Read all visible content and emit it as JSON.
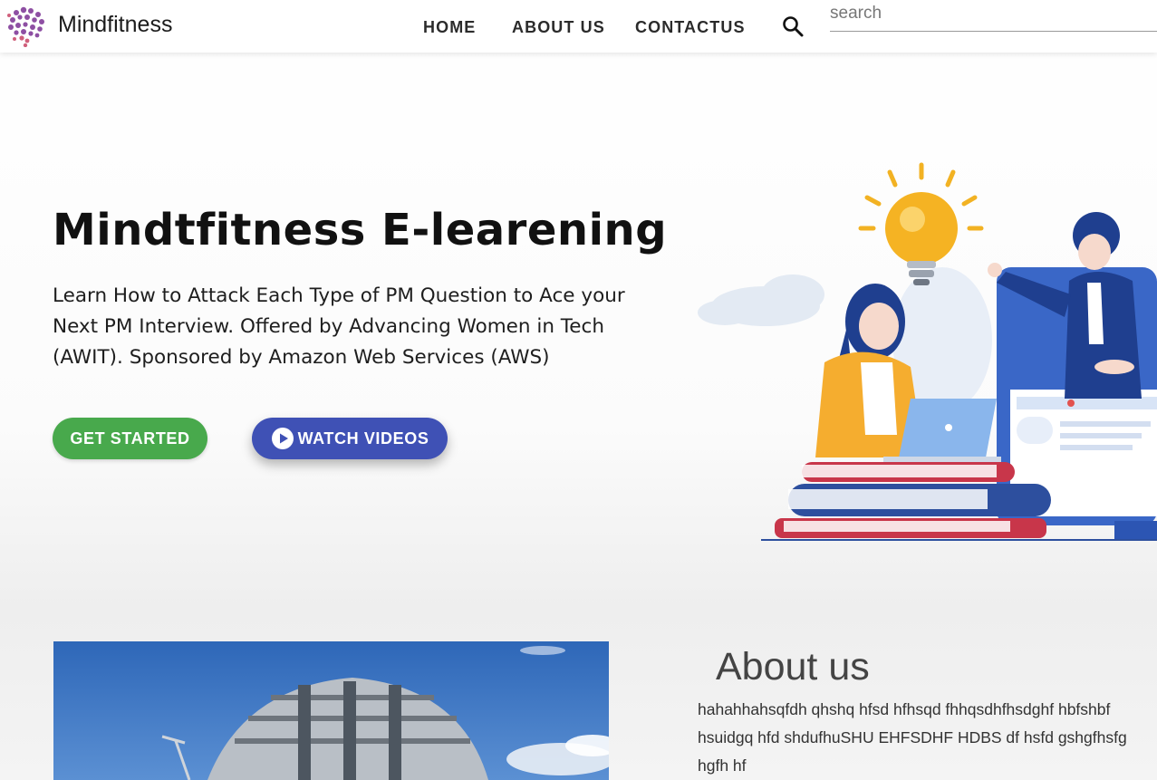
{
  "brand": {
    "name": "Mindfitness",
    "logo_icon": "brain-icon"
  },
  "nav": {
    "home": "HOME",
    "about": "ABOUT US",
    "contact": "CONTACTUS"
  },
  "search": {
    "icon": "search-icon",
    "placeholder": "search",
    "value": ""
  },
  "hero": {
    "title": "Mindtfitness E-learening",
    "subtitle": "Learn How to Attack Each Type of PM Question to Ace your Next PM Interview. Offered by Advancing Women in Tech (AWIT). Sponsored by Amazon Web Services (AWS)",
    "get_started": "GET STARTED",
    "watch_videos": "WATCH VIDEOS",
    "watch_icon": "play-circle-icon"
  },
  "about": {
    "title": "About us",
    "lines": [
      "hahahhahsqfdh qhshq hfsd hfhsqd fhhqsdhfhsdghf hbfshbf",
      "hsuidgq hfd shdufhuSHU EHFSDHF HDBS df hsfd gshgfhsfg",
      "hgfh hf"
    ]
  },
  "colors": {
    "get_started_bg": "#48a94c",
    "watch_videos_bg": "#3f51b5",
    "text_dark": "#111111"
  }
}
